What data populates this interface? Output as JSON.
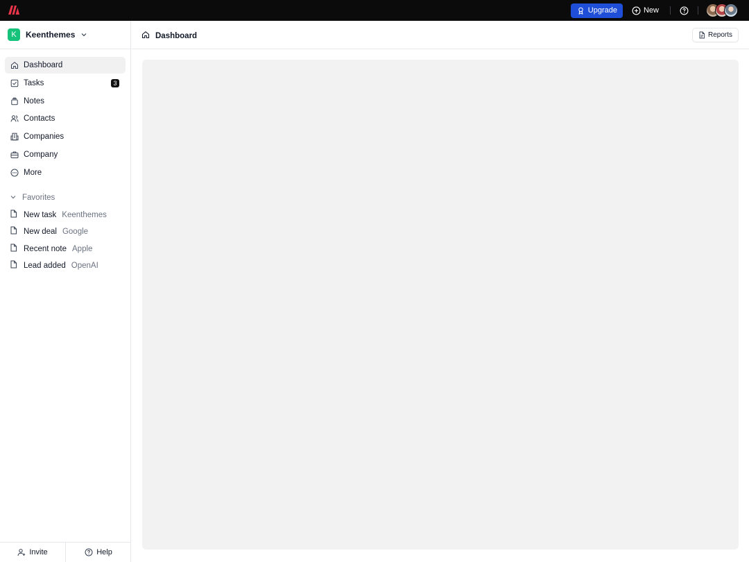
{
  "topbar": {
    "upgrade_label": "Upgrade",
    "new_label": "New",
    "icons": [
      "brand-logo-icon",
      "rocket-icon",
      "plus-circle-icon",
      "help-circle-icon"
    ]
  },
  "sidebar": {
    "workspace_initial": "K",
    "workspace_name": "Keenthemes",
    "nav": [
      {
        "label": "Dashboard",
        "icon": "home-icon",
        "active": true
      },
      {
        "label": "Tasks",
        "icon": "check-square-icon",
        "badge": "3"
      },
      {
        "label": "Notes",
        "icon": "notes-icon"
      },
      {
        "label": "Contacts",
        "icon": "users-icon"
      },
      {
        "label": "Companies",
        "icon": "building-icon"
      },
      {
        "label": "Company",
        "icon": "briefcase-icon"
      },
      {
        "label": "More",
        "icon": "more-circle-icon"
      }
    ],
    "favorites_label": "Favorites",
    "favorites": [
      {
        "title": "New task",
        "sub": "Keenthemes"
      },
      {
        "title": "New deal",
        "sub": "Google"
      },
      {
        "title": "Recent note",
        "sub": "Apple"
      },
      {
        "title": "Lead added",
        "sub": "OpenAI"
      }
    ],
    "footer": {
      "invite_label": "Invite",
      "help_label": "Help"
    }
  },
  "main": {
    "breadcrumb": "Dashboard",
    "reports_label": "Reports"
  },
  "colors": {
    "topbar_bg": "#0b0b0c",
    "upgrade_bg": "#1f4fd8",
    "workspace_badge": "#17c27a",
    "panel_bg": "#f2f2f2"
  }
}
